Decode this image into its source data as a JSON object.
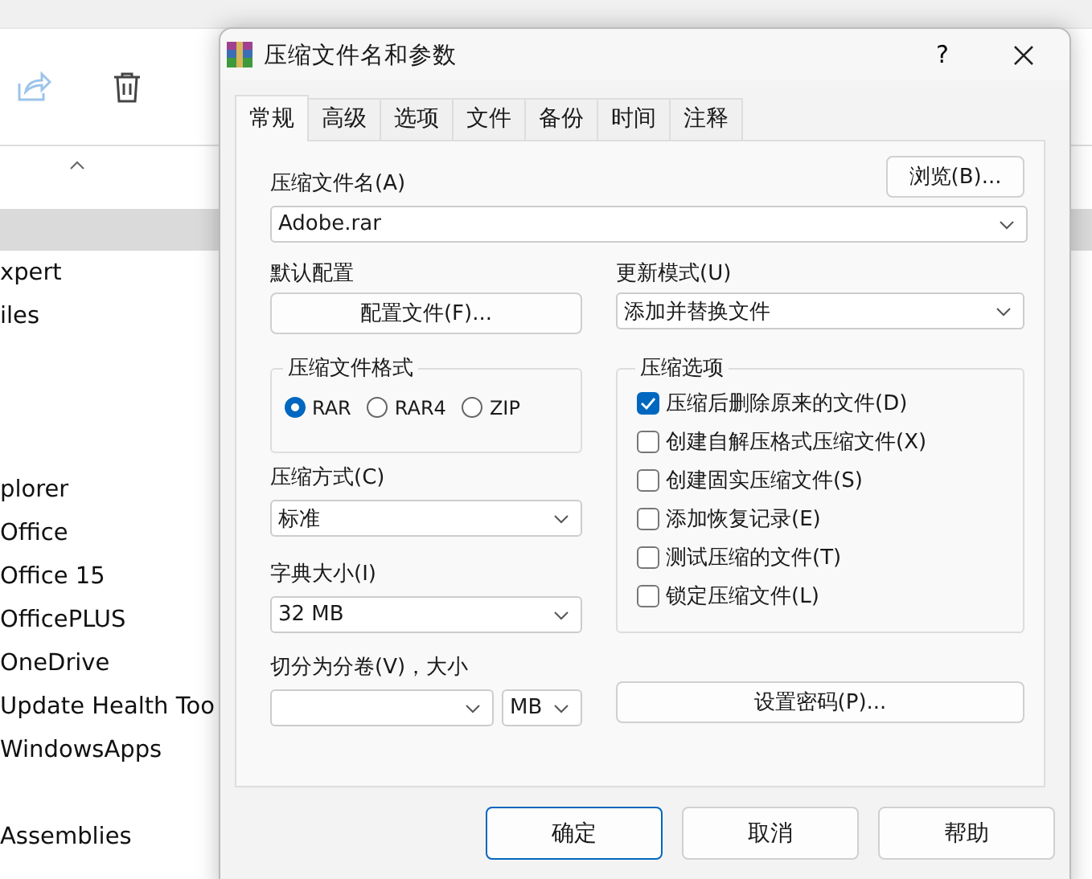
{
  "explorer": {
    "groups": [
      [
        "xpert",
        "iles"
      ],
      [
        "plorer",
        "Office",
        "Office 15",
        "OfficePLUS",
        "OneDrive",
        "Update Health Too",
        "WindowsApps"
      ],
      [
        "Assemblies"
      ]
    ]
  },
  "dialog": {
    "title": "压缩文件名和参数",
    "help": "?",
    "tabs": [
      {
        "label": "常规",
        "selected": true
      },
      {
        "label": "高级",
        "selected": false
      },
      {
        "label": "选项",
        "selected": false
      },
      {
        "label": "文件",
        "selected": false
      },
      {
        "label": "备份",
        "selected": false
      },
      {
        "label": "时间",
        "selected": false
      },
      {
        "label": "注释",
        "selected": false
      }
    ],
    "archive_name": {
      "label": "压缩文件名(A)",
      "browse": "浏览(B)...",
      "value": "Adobe.rar"
    },
    "profile": {
      "label": "默认配置",
      "button": "配置文件(F)..."
    },
    "update_mode": {
      "label": "更新模式(U)",
      "value": "添加并替换文件"
    },
    "format": {
      "title": "压缩文件格式",
      "options": [
        {
          "label": "RAR",
          "selected": true
        },
        {
          "label": "RAR4",
          "selected": false
        },
        {
          "label": "ZIP",
          "selected": false
        }
      ]
    },
    "method": {
      "label": "压缩方式(C)",
      "value": "标准"
    },
    "dictionary": {
      "label": "字典大小(I)",
      "value": "32 MB"
    },
    "split": {
      "label": "切分为分卷(V)，大小",
      "unit": "MB"
    },
    "options": {
      "title": "压缩选项",
      "items": [
        {
          "label": "压缩后删除原来的文件(D)",
          "checked": true
        },
        {
          "label": "创建自解压格式压缩文件(X)",
          "checked": false
        },
        {
          "label": "创建固实压缩文件(S)",
          "checked": false
        },
        {
          "label": "添加恢复记录(E)",
          "checked": false
        },
        {
          "label": "测试压缩的文件(T)",
          "checked": false
        },
        {
          "label": "锁定压缩文件(L)",
          "checked": false
        }
      ]
    },
    "password": "设置密码(P)...",
    "buttons": [
      "确定",
      "取消",
      "帮助"
    ]
  }
}
